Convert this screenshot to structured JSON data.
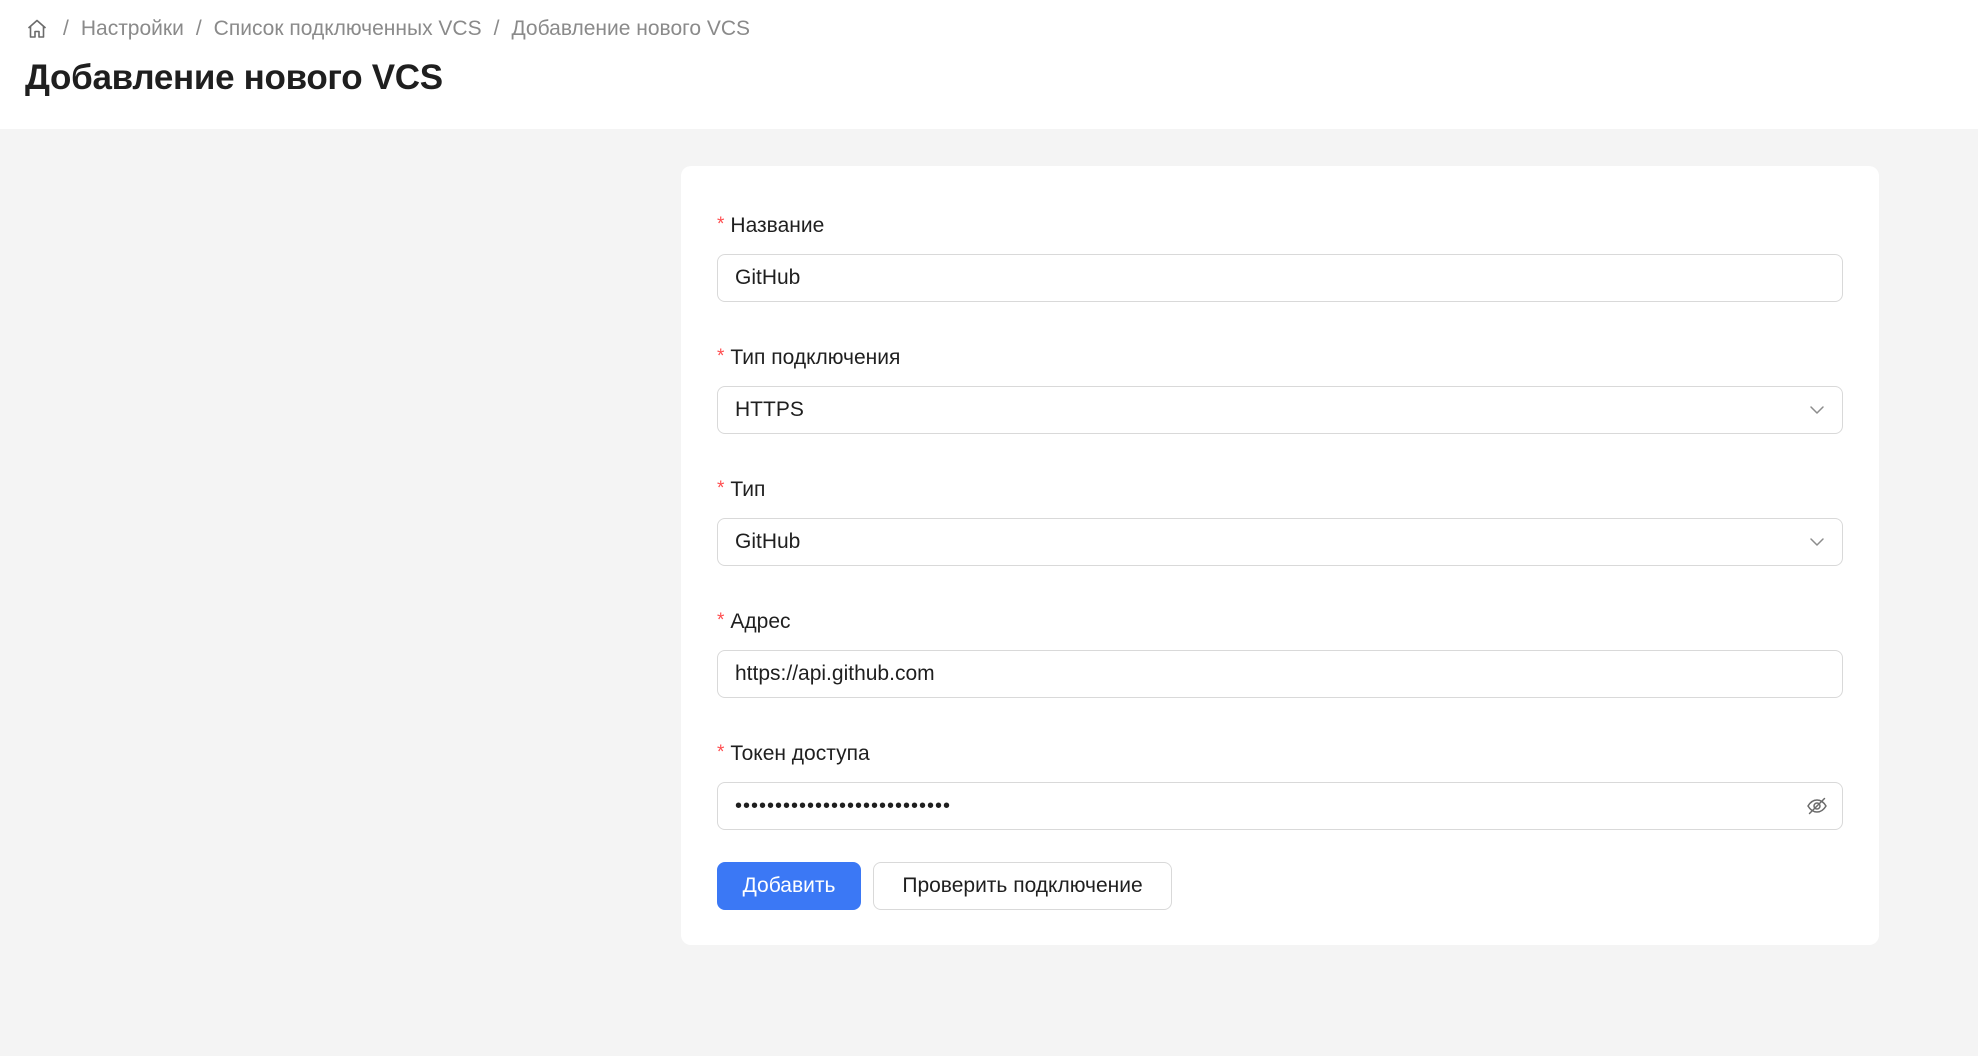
{
  "breadcrumb": {
    "home_icon": "home-icon",
    "separator": "/",
    "items": [
      "Настройки",
      "Список подключенных VCS",
      "Добавление нового VCS"
    ]
  },
  "page": {
    "title": "Добавление нового VCS"
  },
  "form": {
    "required_mark": "*",
    "name": {
      "label": "Название",
      "value": "GitHub"
    },
    "connection_type": {
      "label": "Тип подключения",
      "value": "HTTPS",
      "icon": "chevron-down-icon"
    },
    "type": {
      "label": "Тип",
      "value": "GitHub",
      "icon": "chevron-down-icon"
    },
    "address": {
      "label": "Адрес",
      "value": "https://api.github.com"
    },
    "token": {
      "label": "Токен доступа",
      "value": "•••••••••••••••••••••••••••",
      "icon": "eye-invisible-icon"
    }
  },
  "actions": {
    "add_label": "Добавить",
    "check_label": "Проверить подключение"
  },
  "colors": {
    "primary": "#3b78f5",
    "required": "#ff4d4f",
    "background": "#f4f4f4"
  }
}
